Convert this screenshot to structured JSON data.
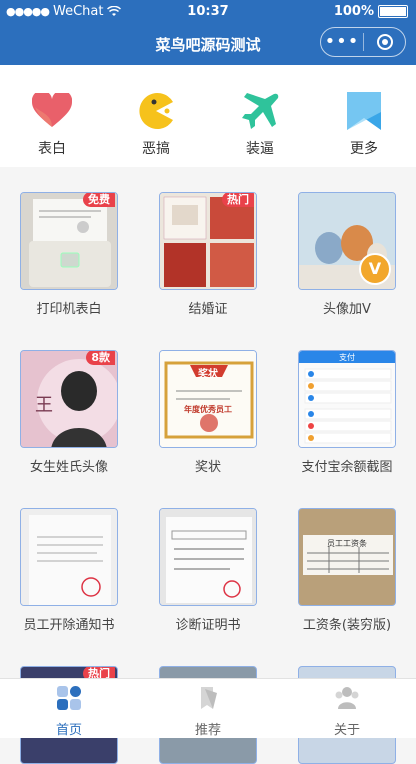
{
  "status": {
    "carrier": "WeChat",
    "time": "10:37",
    "battery": "100%",
    "battery_level": 1.0
  },
  "nav": {
    "title": "菜鸟吧源码测试",
    "more_label": "•••"
  },
  "categories": [
    {
      "label": "表白",
      "icon": "heart-icon",
      "color": "#e9606a"
    },
    {
      "label": "恶搞",
      "icon": "pacman-icon",
      "color": "#f6c21c"
    },
    {
      "label": "装逼",
      "icon": "airplane-icon",
      "color": "#2fc39b"
    },
    {
      "label": "更多",
      "icon": "bookmark-icon",
      "color": "#3aa6e8"
    }
  ],
  "items": [
    {
      "caption": "打印机表白",
      "badge": "免费"
    },
    {
      "caption": "结婚证",
      "badge": "热门"
    },
    {
      "caption": "头像加V",
      "badge": "",
      "overlay": "V"
    },
    {
      "caption": "女生姓氏头像",
      "badge": "8款"
    },
    {
      "caption": "奖状",
      "badge": ""
    },
    {
      "caption": "支付宝余额截图",
      "badge": ""
    },
    {
      "caption": "员工开除通知书",
      "badge": ""
    },
    {
      "caption": "诊断证明书",
      "badge": ""
    },
    {
      "caption": "工资条(装穷版)",
      "badge": ""
    },
    {
      "caption": "",
      "badge": "热门"
    },
    {
      "caption": "",
      "badge": ""
    },
    {
      "caption": "",
      "badge": ""
    }
  ],
  "thumb_texts": {
    "award_title": "奖状",
    "award_subtitle": "年度优秀员工",
    "alipay_title": "支付",
    "salary_title": "员工工资条"
  },
  "tabs": [
    {
      "label": "首页",
      "icon": "home-grid-icon",
      "active": true
    },
    {
      "label": "推荐",
      "icon": "recommend-icon",
      "active": false
    },
    {
      "label": "关于",
      "icon": "about-users-icon",
      "active": false
    }
  ],
  "colors": {
    "primary": "#2c6fbd",
    "badge": "#e9424a"
  }
}
